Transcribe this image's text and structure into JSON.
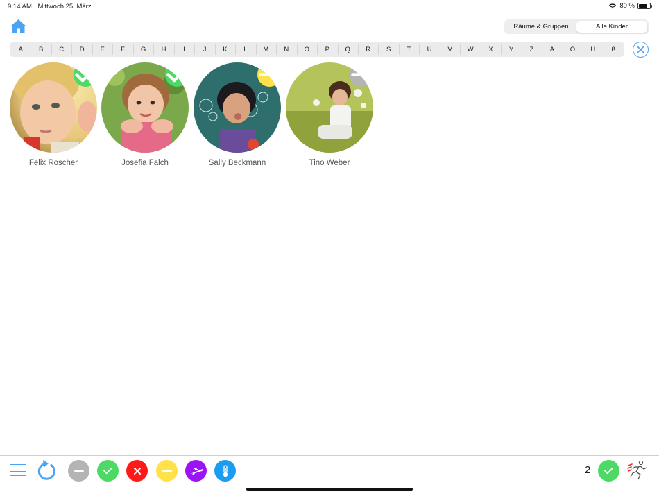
{
  "status_bar": {
    "time": "9:14 AM",
    "date": "Mittwoch 25. März",
    "battery": "80 %",
    "battery_level": 0.8,
    "icons": [
      "wifi-icon",
      "battery-icon"
    ]
  },
  "header": {
    "home_icon": "home-icon",
    "segments": [
      {
        "label": "Räume & Gruppen",
        "active": false
      },
      {
        "label": "Alle Kinder",
        "active": true
      }
    ]
  },
  "alphabet": [
    "A",
    "B",
    "C",
    "D",
    "E",
    "F",
    "G",
    "H",
    "I",
    "J",
    "K",
    "L",
    "M",
    "N",
    "O",
    "P",
    "Q",
    "R",
    "S",
    "T",
    "U",
    "V",
    "W",
    "X",
    "Y",
    "Z",
    "Ä",
    "Ö",
    "Ü",
    "ß"
  ],
  "clear_icon": "close-icon",
  "children": [
    {
      "name": "Felix Roscher",
      "status": "present",
      "status_color": "#4cd964",
      "status_icon": "checkmark-icon"
    },
    {
      "name": "Josefia Falch",
      "status": "present",
      "status_color": "#4cd964",
      "status_icon": "checkmark-icon"
    },
    {
      "name": "Sally Beckmann",
      "status": "pending",
      "status_color": "#ffe14a",
      "status_icon": "minus-icon"
    },
    {
      "name": "Tino Weber",
      "status": "unknown",
      "status_color": "#b4b4b4",
      "status_icon": "minus-icon"
    }
  ],
  "toolbar": {
    "menu_icon": "menu-icon",
    "refresh_icon": "refresh-icon",
    "filters": [
      {
        "name": "filter-unknown",
        "color": "#b4b4b4",
        "icon": "minus-icon"
      },
      {
        "name": "filter-present",
        "color": "#4cd964",
        "icon": "checkmark-icon"
      },
      {
        "name": "filter-absent",
        "color": "#ff1a1a",
        "icon": "x-icon"
      },
      {
        "name": "filter-pending",
        "color": "#ffe14a",
        "icon": "minus-icon"
      },
      {
        "name": "filter-vacation",
        "color": "#9b14f5",
        "icon": "airplane-icon"
      },
      {
        "name": "filter-sick",
        "color": "#1a9cf0",
        "icon": "thermometer-icon"
      }
    ],
    "present_count": "2",
    "present_color": "#4cd964",
    "emergency_icon": "emergency-exit-icon"
  },
  "colors": {
    "accent": "#4ba3f3",
    "present": "#4cd964",
    "pending": "#ffe14a",
    "unknown": "#b4b4b4",
    "absent": "#ff1a1a",
    "vacation": "#9b14f5",
    "sick": "#1a9cf0"
  }
}
